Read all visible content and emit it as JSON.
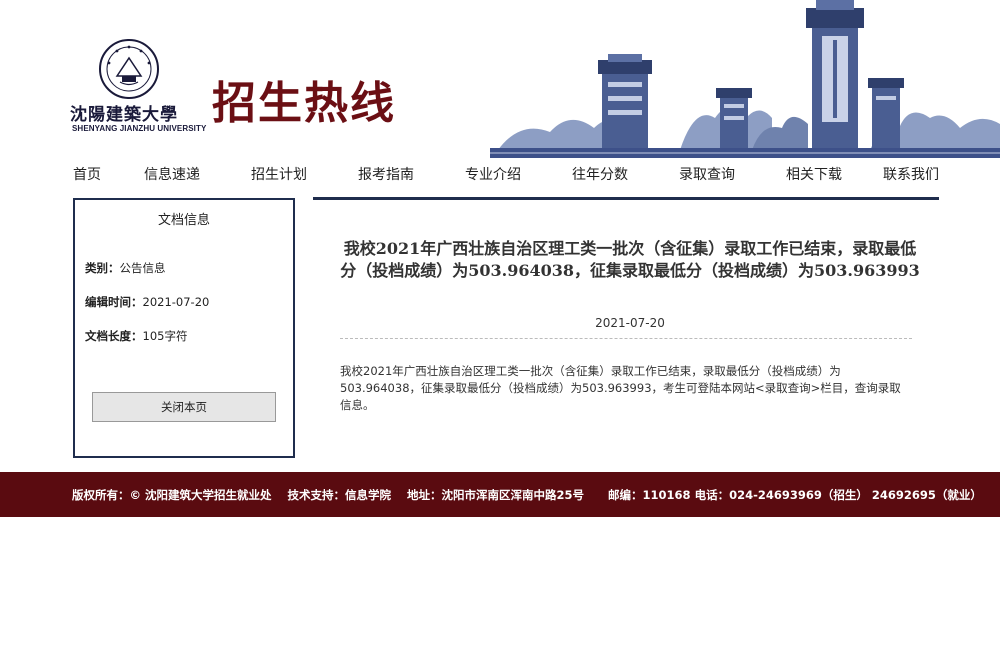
{
  "header": {
    "logo_script": "沈陽建築大學",
    "logo_english": "SHENYANG JIANZHU UNIVERSITY",
    "site_title": "招生热线"
  },
  "nav": {
    "items": [
      {
        "label": "首页"
      },
      {
        "label": "信息速递"
      },
      {
        "label": "招生计划"
      },
      {
        "label": "报考指南"
      },
      {
        "label": "专业介绍"
      },
      {
        "label": "往年分数"
      },
      {
        "label": "录取查询"
      },
      {
        "label": "相关下载"
      },
      {
        "label": "联系我们"
      }
    ]
  },
  "sidebar": {
    "title": "文档信息",
    "category_label": "类别：",
    "category_value": "公告信息",
    "edit_time_label": "编辑时间：",
    "edit_time_value": "2021-07-20",
    "length_label": "文档长度：",
    "length_value": "105字符",
    "close_button": "关闭本页"
  },
  "article": {
    "title": "我校2021年广西壮族自治区理工类一批次（含征集）录取工作已结束，录取最低分（投档成绩）为503.964038，征集录取最低分（投档成绩）为503.963993",
    "date": "2021-07-20",
    "body": "我校2021年广西壮族自治区理工类一批次（含征集）录取工作已结束，录取最低分（投档成绩）为503.964038，征集录取最低分（投档成绩）为503.963993，考生可登陆本网站<录取查询>栏目，查询录取信息。"
  },
  "footer": {
    "text": "版权所有：© 沈阳建筑大学招生就业处    技术支持：信息学院    地址：沈阳市浑南区浑南中路25号      邮编：110168 电话：024-24693969（招生） 24692695（就业）"
  },
  "colors": {
    "brand_red": "#6b0f14",
    "footer_bg": "#5a0b10",
    "frame_navy": "#1f2d4d"
  }
}
